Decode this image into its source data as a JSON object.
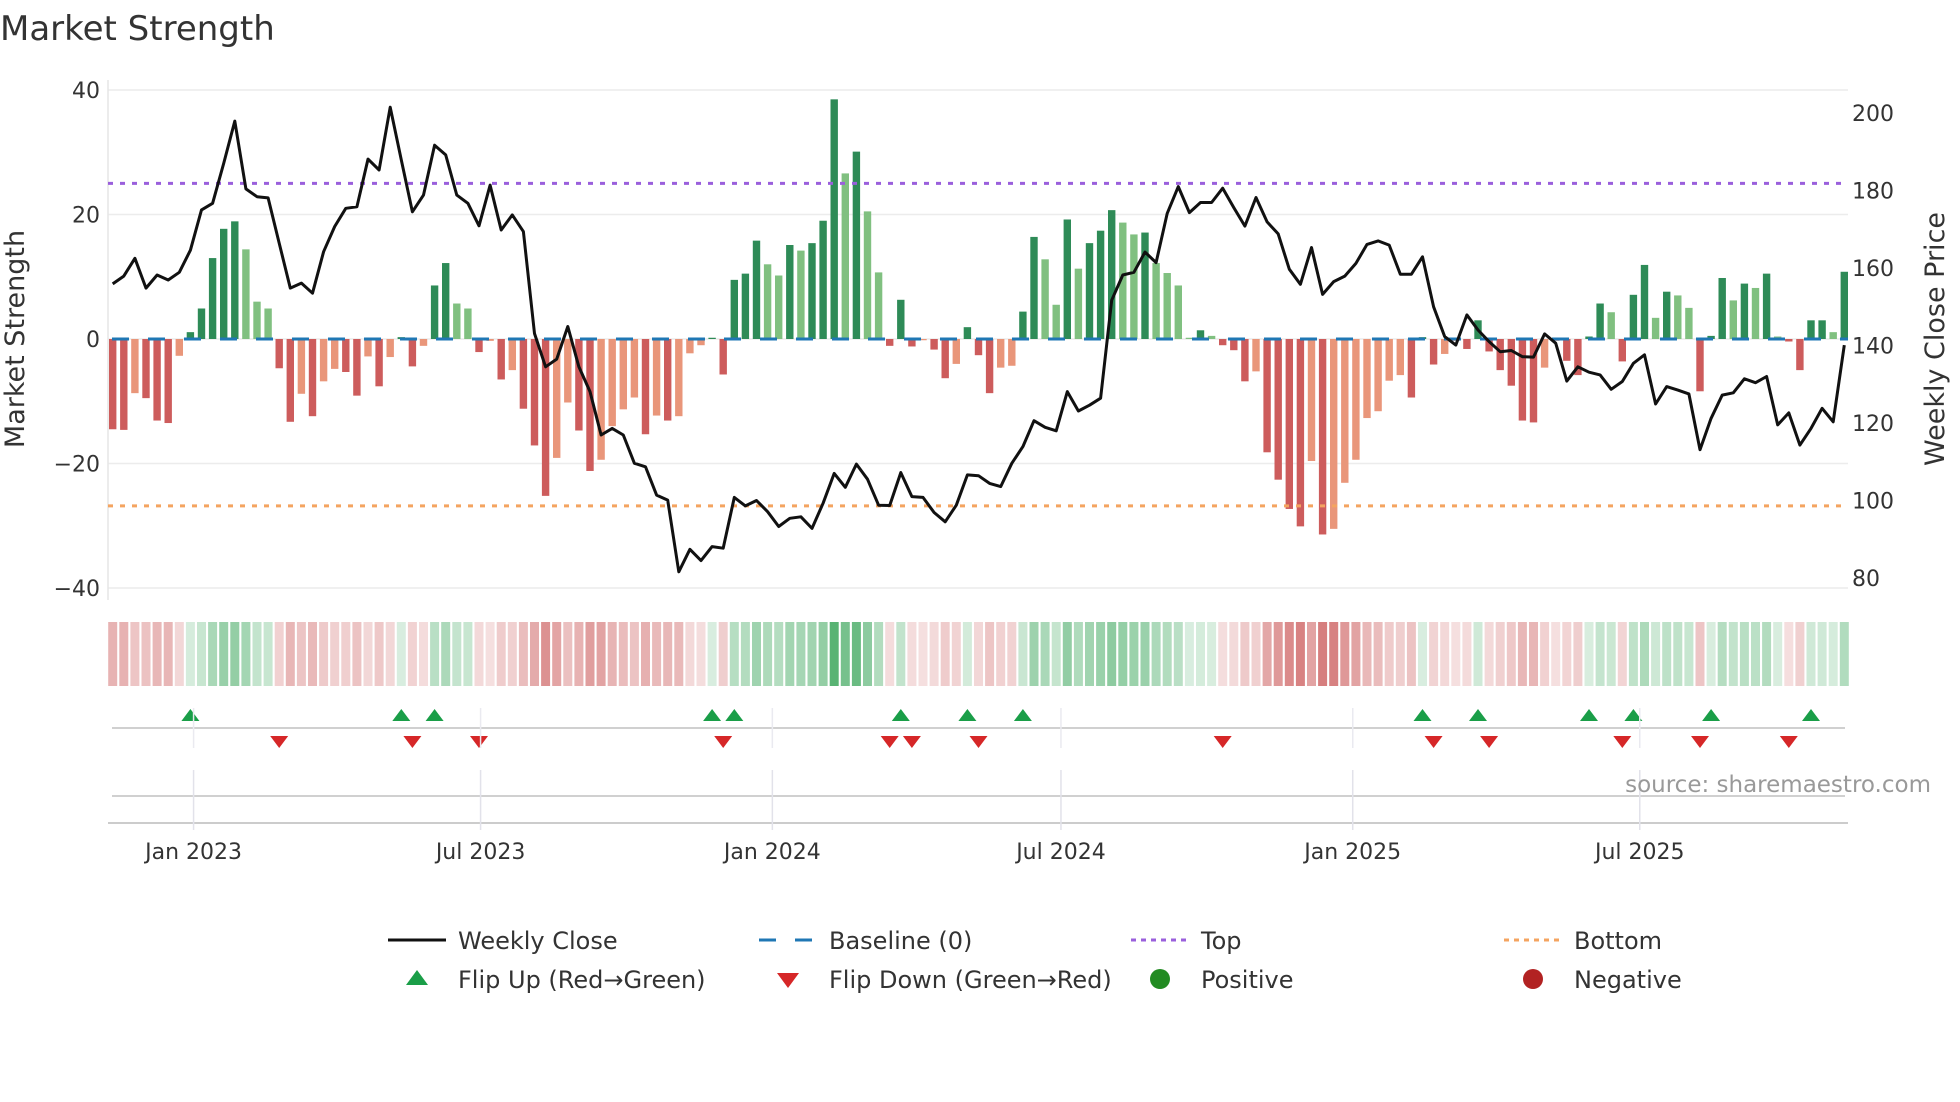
{
  "chart_data": {
    "type": "bar+line",
    "title": "Market Strength",
    "ylabel_left": "Market Strength",
    "ylabel_right": "Weekly Close Price",
    "ylim_left": [
      -40,
      40
    ],
    "ylim_right": [
      80,
      200
    ],
    "yticks_left": [
      "40",
      "20",
      "0",
      "−20",
      "−40"
    ],
    "yticks_left_values": [
      40,
      20,
      0,
      -20,
      -40
    ],
    "yticks_right": [
      "200",
      "180",
      "160",
      "140",
      "120",
      "100",
      "80"
    ],
    "yticks_right_values": [
      200,
      180,
      160,
      140,
      120,
      100,
      80
    ],
    "x_start_date": "2022-11-11",
    "x_step_days": 7,
    "xticks": [
      {
        "label": "Jan 2023",
        "date": "2023-01-01"
      },
      {
        "label": "Jul 2023",
        "date": "2023-07-01"
      },
      {
        "label": "Jan 2024",
        "date": "2024-01-01"
      },
      {
        "label": "Jul 2024",
        "date": "2024-07-01"
      },
      {
        "label": "Jan 2025",
        "date": "2025-01-01"
      },
      {
        "label": "Jul 2025",
        "date": "2025-07-01"
      }
    ],
    "top_level": 25,
    "bottom_level": -26.8,
    "baseline": 0,
    "strength": [
      -14.5,
      -14.6,
      -8.7,
      -9.5,
      -13.1,
      -13.5,
      -2.7,
      1.1,
      4.9,
      13,
      17.7,
      18.9,
      14.4,
      6,
      4.9,
      -4.7,
      -13.3,
      -8.8,
      -12.4,
      -6.8,
      -4.8,
      -5.3,
      -9.1,
      -2.8,
      -7.6,
      -2.9,
      0.3,
      -4.4,
      -1.1,
      8.6,
      12.2,
      5.7,
      4.9,
      -2.1,
      -0.3,
      -6.5,
      -5,
      -11.2,
      -17.1,
      -25.2,
      -19.1,
      -10.2,
      -14.7,
      -21.2,
      -19.4,
      -14,
      -11.3,
      -9.4,
      -15.3,
      -12.3,
      -13.1,
      -12.4,
      -2.3,
      -1,
      0.2,
      -5.7,
      9.5,
      10.5,
      15.8,
      12,
      10.2,
      15.1,
      14.2,
      15.4,
      19,
      38.5,
      26.6,
      30.1,
      20.5,
      10.7,
      -1.1,
      6.3,
      -1.2,
      -0.2,
      -1.7,
      -6.3,
      -4,
      1.9,
      -2.6,
      -8.7,
      -4.6,
      -4.3,
      4.4,
      16.4,
      12.8,
      5.5,
      19.2,
      11.3,
      15.4,
      17.4,
      20.7,
      18.7,
      16.8,
      17.1,
      12.2,
      10.6,
      8.6,
      0.2,
      1.4,
      0.5,
      -1,
      -1.8,
      -6.8,
      -5.2,
      -18.2,
      -22.6,
      -27.3,
      -30.1,
      -19.6,
      -31.4,
      -30.5,
      -23.1,
      -19.4,
      -12.7,
      -11.6,
      -6.7,
      -5.8,
      -9.4,
      0.3,
      -4.1,
      -2.4,
      -0.3,
      -1.6,
      3,
      -2,
      -5,
      -7.5,
      -13.1,
      -13.4,
      -4.6,
      -0.3,
      -3.5,
      -5.8,
      0.4,
      5.7,
      4.3,
      -3.6,
      7.1,
      11.9,
      3.4,
      7.6,
      7,
      5,
      -8.4,
      0.5,
      9.8,
      6.2,
      8.9,
      8.2,
      10.5,
      0.4,
      -0.4,
      -5,
      3,
      3,
      1.1,
      10.8
    ],
    "close": [
      155.9,
      157.9,
      162.5,
      154.8,
      158.2,
      156.9,
      158.9,
      164.6,
      175,
      176.7,
      187,
      197.9,
      180.4,
      178.4,
      178.1,
      166.4,
      154.8,
      156.1,
      153.5,
      164.2,
      170.7,
      175.4,
      175.8,
      188.1,
      185.3,
      201.5,
      187.9,
      174.5,
      178.8,
      191.7,
      189.2,
      178.8,
      176.7,
      170.9,
      181.4,
      169.8,
      173.7,
      169.4,
      143.1,
      134.5,
      136.5,
      144.9,
      134.5,
      128.1,
      116.9,
      118.6,
      116.9,
      109.6,
      108.7,
      101.4,
      100.1,
      81.6,
      87.4,
      84.5,
      88.1,
      87.7,
      100.8,
      98.6,
      100,
      97.1,
      93.3,
      95.4,
      95.8,
      92.8,
      99.3,
      107,
      103.4,
      109.4,
      105.5,
      98.8,
      98.7,
      107.2,
      101,
      100.8,
      96.9,
      94.5,
      98.8,
      106.6,
      106.4,
      104.4,
      103.6,
      109.6,
      113.9,
      120.6,
      118.9,
      118,
      128.1,
      123.1,
      124.6,
      126.4,
      151.7,
      158.2,
      158.9,
      164.1,
      161.4,
      174.1,
      181,
      174.3,
      176.9,
      176.9,
      180.6,
      175.6,
      170.8,
      178.2,
      171.9,
      168.8,
      159.7,
      155.8,
      165.3,
      153.2,
      156.5,
      157.9,
      161.2,
      166.1,
      167,
      165.9,
      158.4,
      158.4,
      162.9,
      150,
      142.3,
      140.1,
      147.9,
      144,
      141,
      138.4,
      138.7,
      137.1,
      137,
      143,
      140.6,
      130.8,
      134.5,
      133.1,
      132.4,
      128.7,
      130.7,
      135.4,
      137.6,
      124.9,
      129.4,
      128.5,
      127.5,
      113.1,
      121.2,
      127.2,
      127.8,
      131.4,
      130.4,
      132,
      119.5,
      122.6,
      114.3,
      118.6,
      123.8,
      120.3,
      140.1
    ],
    "legend": {
      "placement": "bottom",
      "items": [
        {
          "label": "Weekly Close",
          "kind": "line"
        },
        {
          "label": "Baseline (0)",
          "kind": "dash"
        },
        {
          "label": "Top",
          "kind": "dot-purple"
        },
        {
          "label": "Bottom",
          "kind": "dot-orange"
        },
        {
          "label": "Flip Up (Red→Green)",
          "kind": "tri-up"
        },
        {
          "label": "Flip Down (Green→Red)",
          "kind": "tri-down"
        },
        {
          "label": "Positive",
          "kind": "circle-green"
        },
        {
          "label": "Negative",
          "kind": "circle-red"
        }
      ]
    },
    "source": "source: sharemaestro.com",
    "colors": {
      "dark_green": "#2e8b57",
      "light_green": "#80c080",
      "dark_red": "#cd5c5c",
      "light_red": "#e9967a",
      "close": "#111111",
      "baseline": "#1f77b4",
      "top": "#9a5fdc",
      "bottom": "#f4a460",
      "flip_up": "#1a9e48",
      "flip_down": "#d62728",
      "positive": "#228b22",
      "negative": "#b22222"
    }
  }
}
